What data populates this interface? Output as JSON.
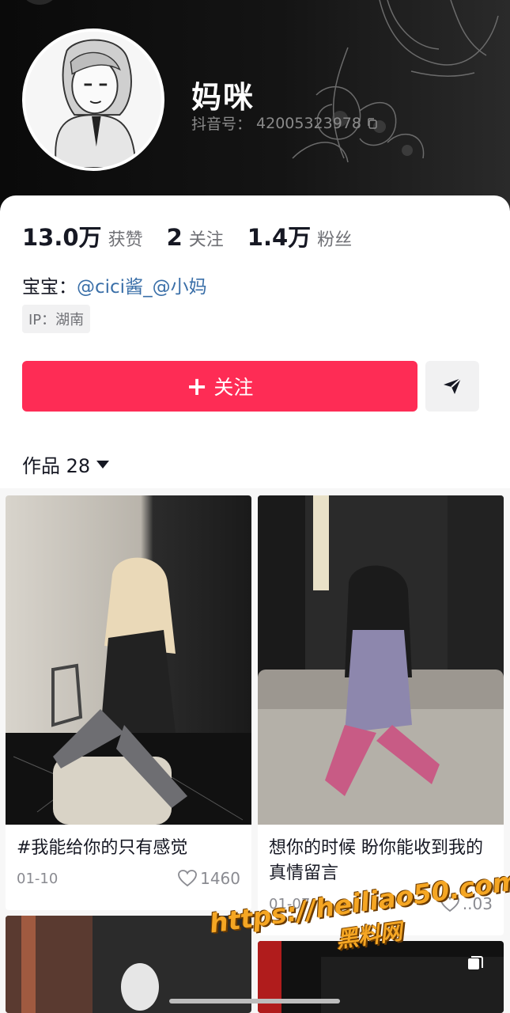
{
  "profile": {
    "nickname": "妈咪",
    "douyin_id_label": "抖音号：",
    "douyin_id": "42005323978",
    "stats": [
      {
        "value": "13.0万",
        "label": "获赞"
      },
      {
        "value": "2",
        "label": "关注"
      },
      {
        "value": "1.4万",
        "label": "粉丝"
      }
    ],
    "bio_prefix": "宝宝：",
    "bio_mentions": "@cici酱_@小妈",
    "ip": "IP：湖南"
  },
  "actions": {
    "follow_label": "关注",
    "share_icon": "send-icon"
  },
  "tabs": {
    "works_label": "作品 28"
  },
  "videos": [
    {
      "title": "#我能给你的只有感觉",
      "date": "01-10",
      "likes": "1460"
    },
    {
      "title": "想你的时候 盼你能收到我的真情留言",
      "date": "01-07",
      "likes": "..03"
    }
  ],
  "watermark": {
    "url": "https://heiliao50.com",
    "site": "黑料网"
  },
  "colors": {
    "accent": "#fe2c55",
    "mention": "#3a6fa8"
  }
}
